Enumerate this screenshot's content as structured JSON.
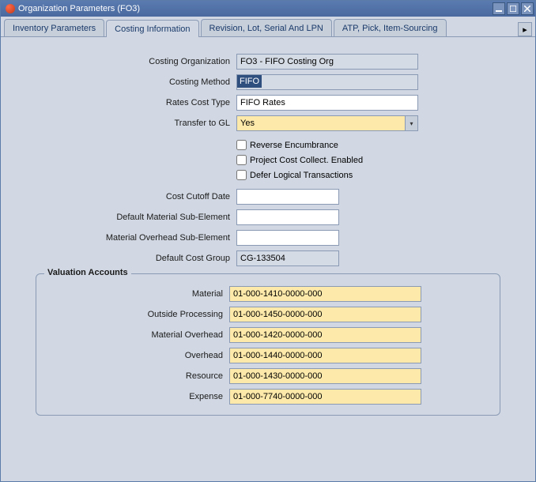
{
  "window": {
    "title": "Organization Parameters (FO3)"
  },
  "tabs": [
    {
      "label": "Inventory Parameters"
    },
    {
      "label": "Costing Information"
    },
    {
      "label": "Revision, Lot, Serial And LPN"
    },
    {
      "label": "ATP, Pick, Item-Sourcing"
    }
  ],
  "form": {
    "costing_org_label": "Costing Organization",
    "costing_org_value": "FO3 - FIFO Costing Org",
    "costing_method_label": "Costing Method",
    "costing_method_value": "FIFO",
    "rates_cost_type_label": "Rates Cost Type",
    "rates_cost_type_value": "FIFO Rates",
    "transfer_gl_label": "Transfer to GL",
    "transfer_gl_value": "Yes",
    "reverse_encumbrance_label": "Reverse Encumbrance",
    "project_cost_label": "Project Cost Collect. Enabled",
    "defer_logical_label": "Defer Logical Transactions",
    "cost_cutoff_label": "Cost Cutoff Date",
    "cost_cutoff_value": "",
    "default_material_sub_label": "Default Material Sub-Element",
    "default_material_sub_value": "",
    "material_overhead_sub_label": "Material Overhead Sub-Element",
    "material_overhead_sub_value": "",
    "default_cost_group_label": "Default Cost Group",
    "default_cost_group_value": "CG-133504"
  },
  "valuation": {
    "legend": "Valuation Accounts",
    "material_label": "Material",
    "material_value": "01-000-1410-0000-000",
    "outside_label": "Outside Processing",
    "outside_value": "01-000-1450-0000-000",
    "mat_overhead_label": "Material Overhead",
    "mat_overhead_value": "01-000-1420-0000-000",
    "overhead_label": "Overhead",
    "overhead_value": "01-000-1440-0000-000",
    "resource_label": "Resource",
    "resource_value": "01-000-1430-0000-000",
    "expense_label": "Expense",
    "expense_value": "01-000-7740-0000-000"
  }
}
